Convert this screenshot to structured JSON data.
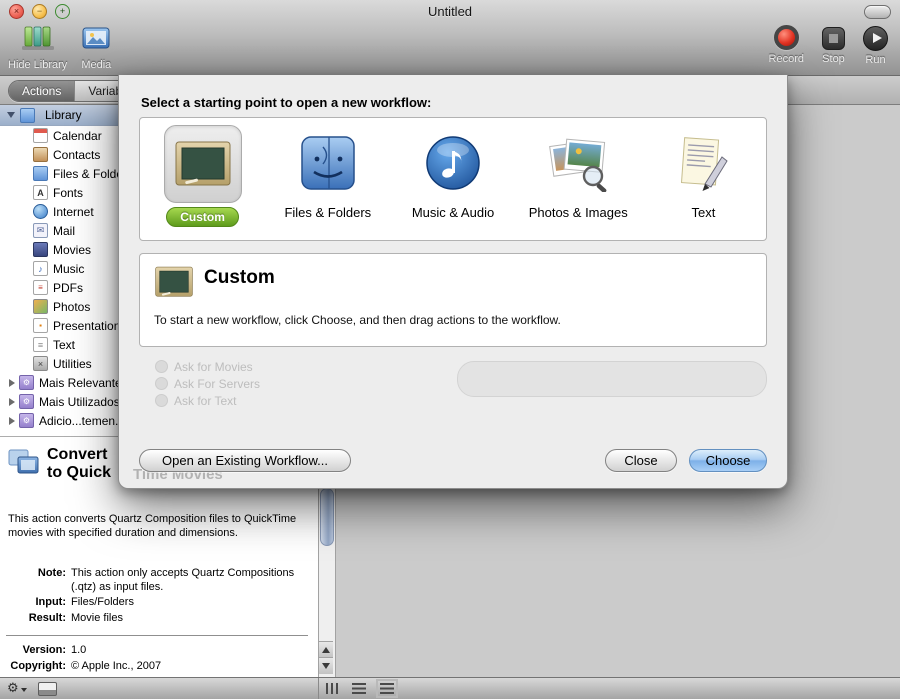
{
  "window": {
    "title": "Untitled"
  },
  "toolbar": {
    "hide_library_label": "Hide Library",
    "media_label": "Media",
    "record_label": "Record",
    "stop_label": "Stop",
    "run_label": "Run"
  },
  "tabs": {
    "actions_label": "Actions",
    "variables_label": "Variables"
  },
  "sidebar": {
    "root_label": "Library",
    "items": [
      {
        "label": "Calendar",
        "icon": "calendar-icon"
      },
      {
        "label": "Contacts",
        "icon": "contacts-icon"
      },
      {
        "label": "Files & Folders",
        "icon": "folder-icon"
      },
      {
        "label": "Fonts",
        "icon": "fonts-icon"
      },
      {
        "label": "Internet",
        "icon": "internet-icon"
      },
      {
        "label": "Mail",
        "icon": "mail-icon"
      },
      {
        "label": "Movies",
        "icon": "movies-icon"
      },
      {
        "label": "Music",
        "icon": "music-icon"
      },
      {
        "label": "PDFs",
        "icon": "pdfs-icon"
      },
      {
        "label": "Photos",
        "icon": "photos-icon"
      },
      {
        "label": "Presentations",
        "icon": "presentations-icon"
      },
      {
        "label": "Text",
        "icon": "text-icon"
      },
      {
        "label": "Utilities",
        "icon": "utilities-icon"
      }
    ],
    "groups": [
      {
        "label": "Mais Relevantes",
        "icon": "smart-folder-icon"
      },
      {
        "label": "Mais Utilizados",
        "icon": "smart-folder-icon"
      },
      {
        "label": "Adicio...temen...",
        "icon": "smart-folder-icon"
      }
    ]
  },
  "dialog": {
    "prompt": "Select a starting point to open a new workflow:",
    "starting_points": [
      {
        "label": "Custom",
        "selected": true
      },
      {
        "label": "Files & Folders",
        "selected": false
      },
      {
        "label": "Music & Audio",
        "selected": false
      },
      {
        "label": "Photos & Images",
        "selected": false
      },
      {
        "label": "Text",
        "selected": false
      }
    ],
    "detail_title": "Custom",
    "detail_description": "To start a new workflow, click Choose, and then drag actions to the workflow.",
    "ghost_items": [
      "Ask for Movies",
      "Ask For Servers",
      "Ask for Text"
    ],
    "ghost_title": "Time Movies",
    "open_existing_label": "Open an Existing Workflow...",
    "close_label": "Close",
    "choose_label": "Choose"
  },
  "description_panel": {
    "title_line1": "Convert",
    "title_line2": "to Quick",
    "body": "This action converts Quartz Composition files to QuickTime movies with specified duration and dimensions.",
    "fields": [
      {
        "label": "Note:",
        "value": "This action only accepts Quartz Compositions (.qtz) as input files."
      },
      {
        "label": "Input:",
        "value": "Files/Folders"
      },
      {
        "label": "Result:",
        "value": "Movie files"
      }
    ],
    "meta": [
      {
        "label": "Version:",
        "value": "1.0"
      },
      {
        "label": "Copyright:",
        "value": "© Apple Inc., 2007"
      }
    ]
  },
  "colors": {
    "selection_green": "#6aa622",
    "choose_blue": "#7db0e8"
  }
}
